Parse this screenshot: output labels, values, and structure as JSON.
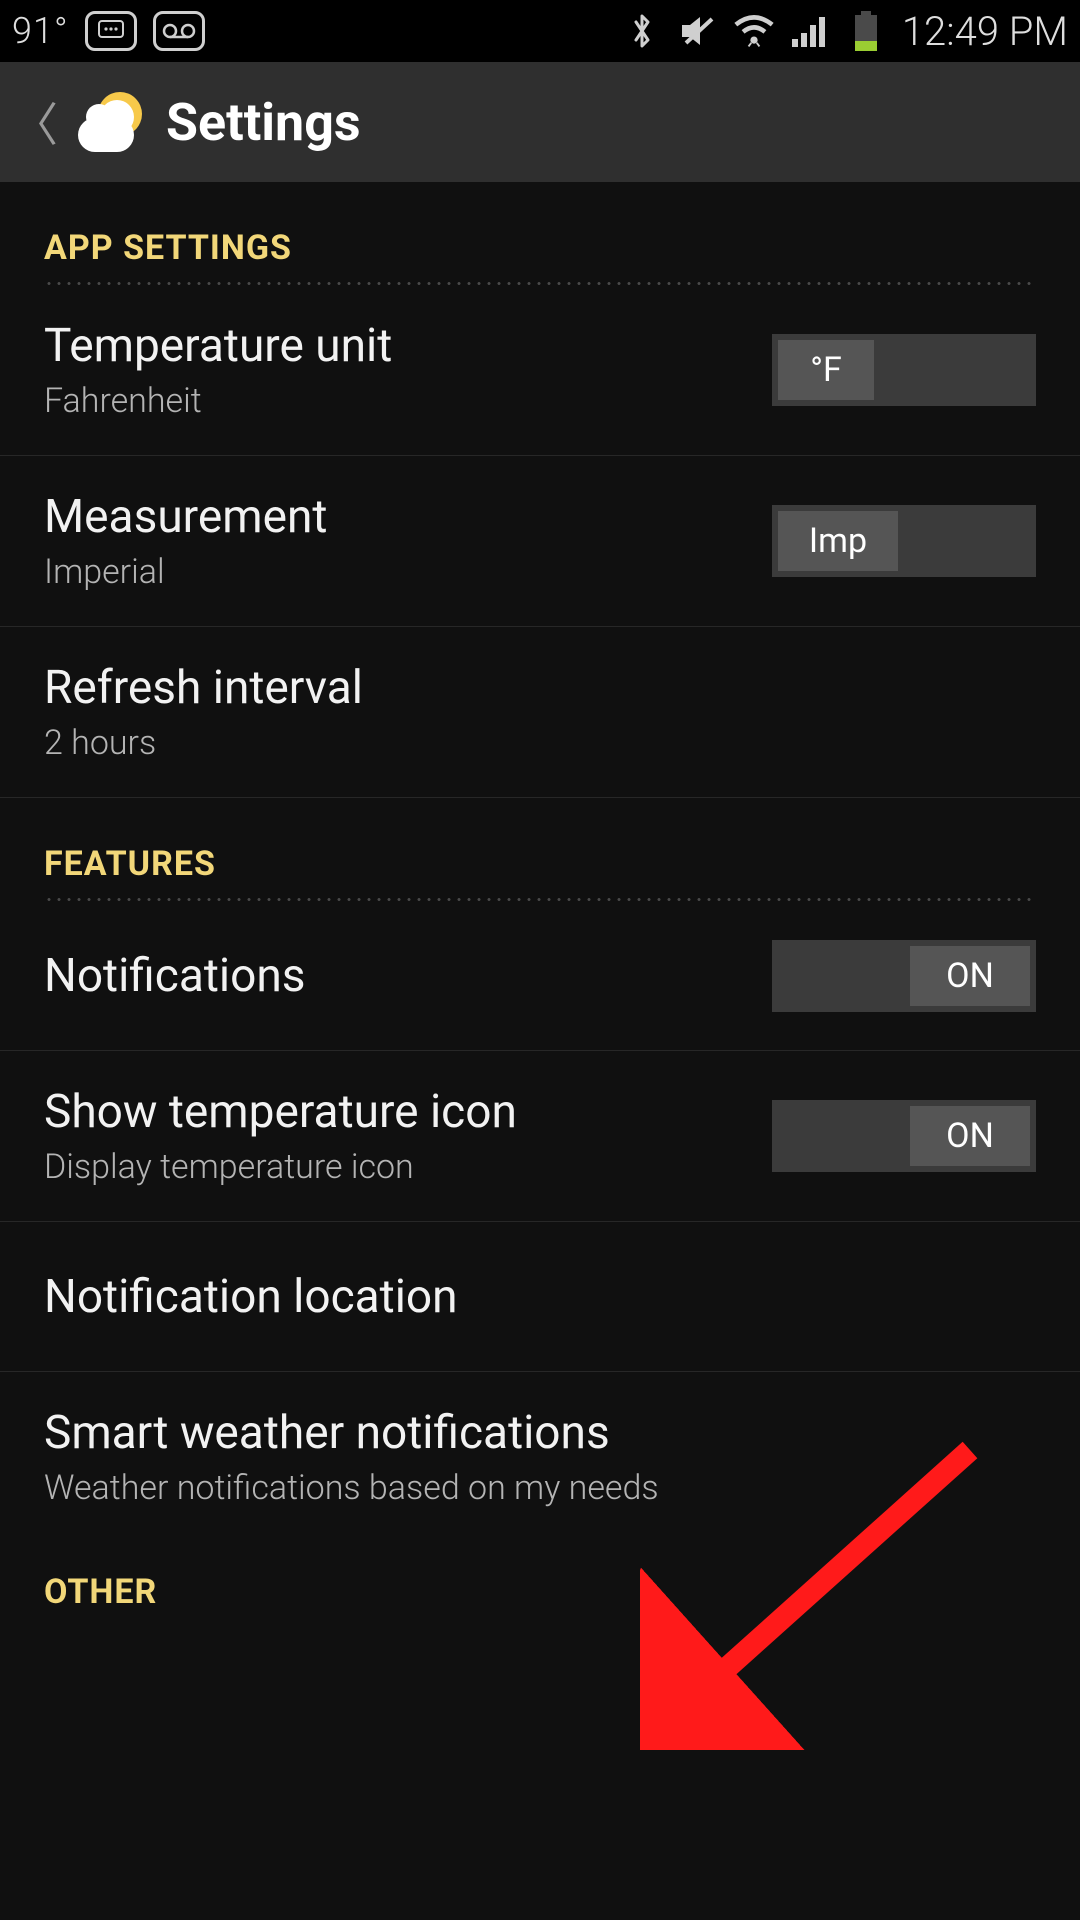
{
  "status": {
    "temperature": "91°",
    "time": "12:49 PM"
  },
  "appbar": {
    "title": "Settings"
  },
  "sections": {
    "app_settings": {
      "header": "APP SETTINGS",
      "temperature_unit": {
        "title": "Temperature unit",
        "subtitle": "Fahrenheit",
        "toggle_label": "°F"
      },
      "measurement": {
        "title": "Measurement",
        "subtitle": "Imperial",
        "toggle_label": "Imp"
      },
      "refresh_interval": {
        "title": "Refresh interval",
        "subtitle": "2 hours"
      }
    },
    "features": {
      "header": "FEATURES",
      "notifications": {
        "title": "Notifications",
        "toggle_label": "ON"
      },
      "show_temp_icon": {
        "title": "Show temperature icon",
        "subtitle": "Display temperature icon",
        "toggle_label": "ON"
      },
      "notification_location": {
        "title": "Notification location"
      },
      "smart_weather": {
        "title": "Smart weather notifications",
        "subtitle": "Weather notifications based on my needs"
      }
    },
    "other": {
      "header": "OTHER"
    }
  }
}
